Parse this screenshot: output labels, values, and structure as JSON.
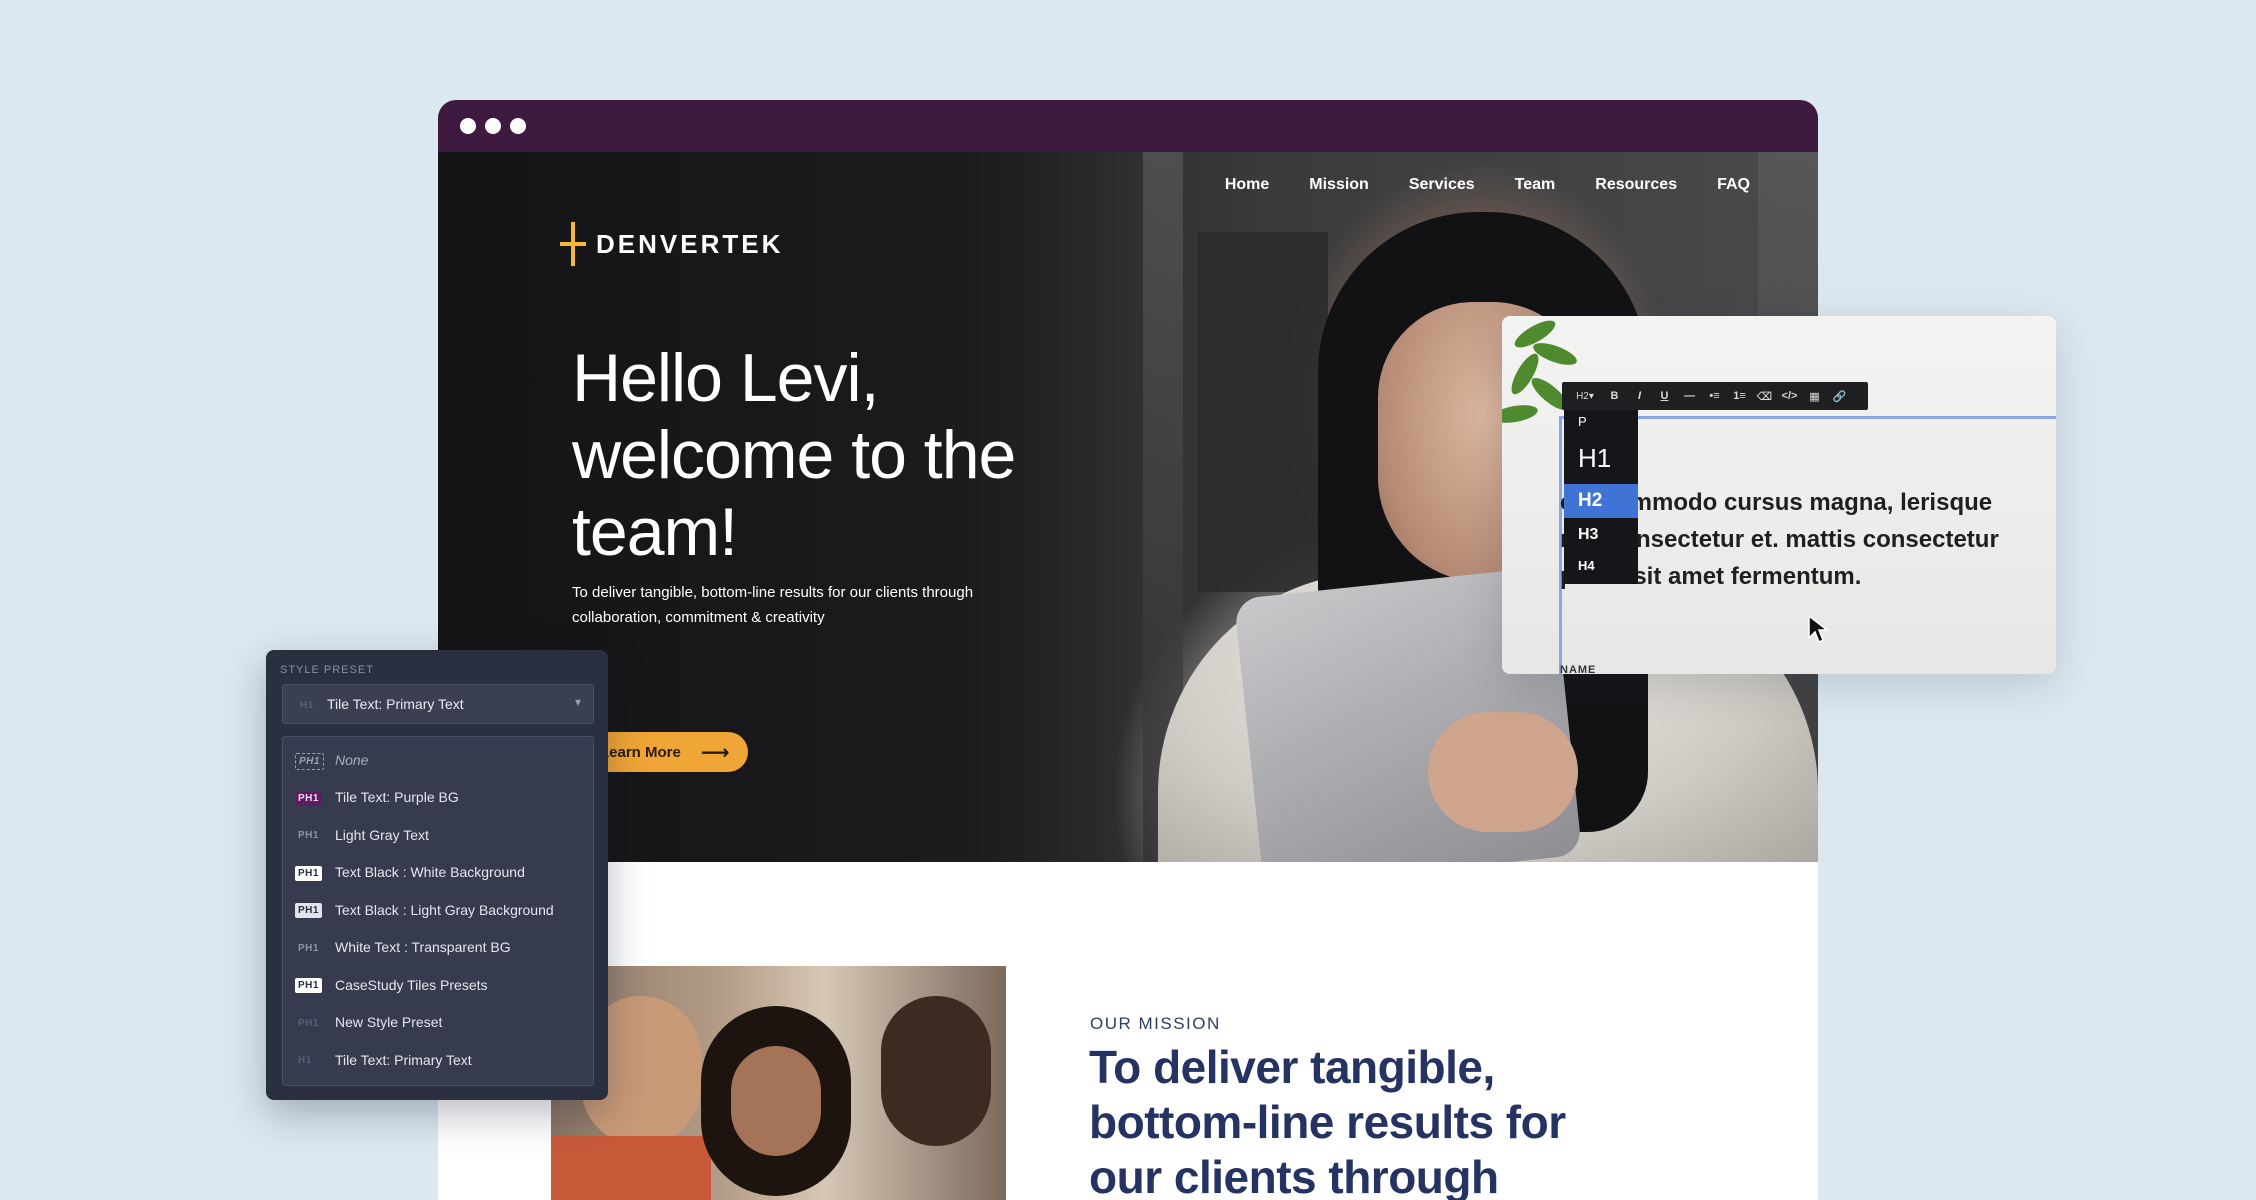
{
  "window": {
    "controls": [
      "dot",
      "dot",
      "dot"
    ]
  },
  "nav": {
    "items": [
      "Home",
      "Mission",
      "Services",
      "Team",
      "Resources",
      "FAQ"
    ]
  },
  "brand": {
    "name": "DENVERTEK",
    "accent": "#f5b93a"
  },
  "hero": {
    "title": "Hello Levi, welcome to the team!",
    "subtitle": "To deliver tangible, bottom-line results for our clients through collaboration, commitment & creativity",
    "cta_label": "Learn More",
    "cta_icon": "arrow-right-icon",
    "cta_color": "#f0a636"
  },
  "mission": {
    "kicker": "OUR MISSION",
    "heading": "To deliver tangible, bottom-line results for our clients through"
  },
  "editor": {
    "toolbar": {
      "heading_select": "H2",
      "buttons": [
        "B",
        "I",
        "U",
        "—",
        "•≡",
        "1≡",
        "⌫",
        "</>",
        "▦",
        "🔗"
      ]
    },
    "heading_menu": {
      "options": [
        "P",
        "H1",
        "H2",
        "H3",
        "H4"
      ],
      "selected": "H2"
    },
    "body_text": "ent commodo cursus magna, lerisque nisl consectetur et. mattis consectetur purus sit amet fermentum.",
    "field_label": "NAME"
  },
  "style_preset": {
    "label": "STYLE PRESET",
    "selected": {
      "badge": "H1",
      "label": "Tile Text: Primary Text"
    },
    "options": [
      {
        "badge": "PH1",
        "label": "None",
        "style": "dashed"
      },
      {
        "badge": "PH1",
        "label": "Tile Text: Purple BG",
        "style": "purple"
      },
      {
        "badge": "PH1",
        "label": "Light Gray Text",
        "style": "gray"
      },
      {
        "badge": "PH1",
        "label": "Text Black : White Background",
        "style": "white"
      },
      {
        "badge": "PH1",
        "label": "Text Black : Light Gray Background",
        "style": "light"
      },
      {
        "badge": "PH1",
        "label": "White Text : Transparent BG",
        "style": "gray"
      },
      {
        "badge": "PH1",
        "label": "CaseStudy Tiles Presets",
        "style": "white"
      },
      {
        "badge": "PH1",
        "label": "New Style Preset",
        "style": "dim"
      },
      {
        "badge": "H1",
        "label": "Tile Text: Primary Text",
        "style": "dim"
      }
    ]
  },
  "colors": {
    "background": "#dce8f0",
    "titlebar": "#3e1a40",
    "mission_heading": "#253362",
    "menu_highlight": "#3f74d6"
  }
}
